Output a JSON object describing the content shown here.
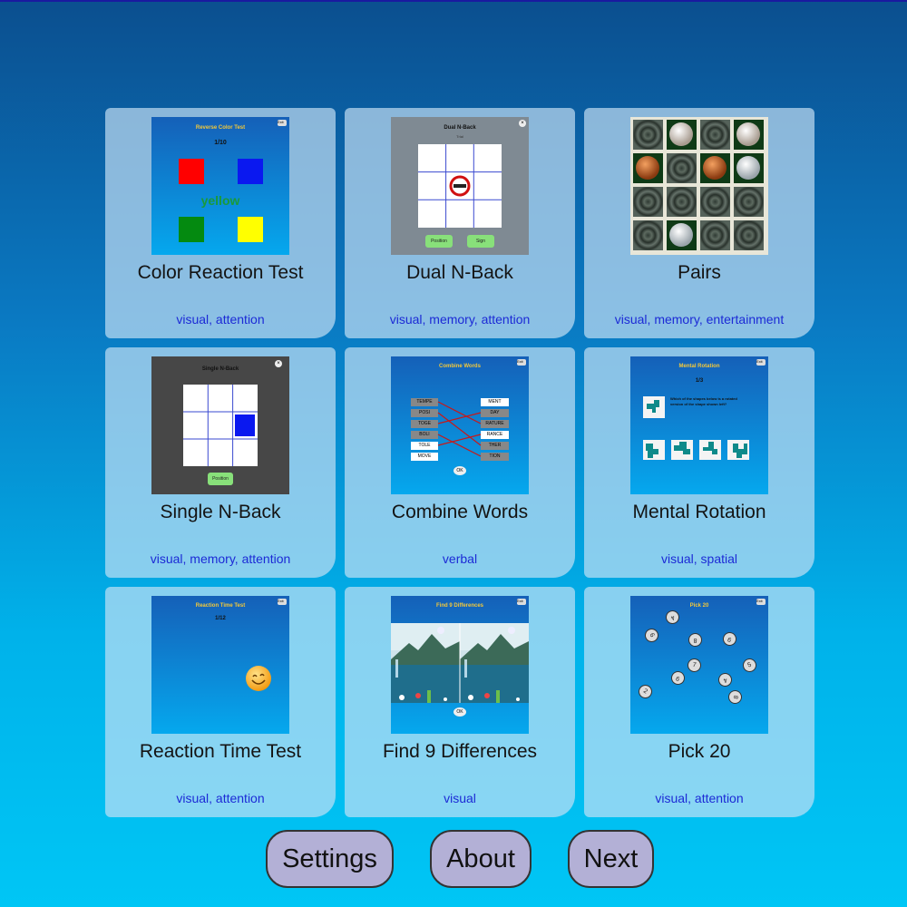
{
  "games": [
    {
      "title": "Color Reaction Test",
      "tags": "visual, attention"
    },
    {
      "title": "Dual N-Back",
      "tags": "visual, memory, attention"
    },
    {
      "title": "Pairs",
      "tags": "visual, memory, entertainment"
    },
    {
      "title": "Single N-Back",
      "tags": "visual, memory, attention"
    },
    {
      "title": "Combine Words",
      "tags": "verbal"
    },
    {
      "title": "Mental Rotation",
      "tags": "visual, spatial"
    },
    {
      "title": "Reaction Time Test",
      "tags": "visual, attention"
    },
    {
      "title": "Find 9 Differences",
      "tags": "visual"
    },
    {
      "title": "Pick 20",
      "tags": "visual, attention"
    }
  ],
  "thumbs": {
    "exit": "Exit",
    "color": {
      "title": "Reverse Color Test",
      "counter": "1/10",
      "word": "yellow"
    },
    "dual": {
      "title": "Dual N-Back",
      "sub": "Trial",
      "position": "Position",
      "sign": "Sign"
    },
    "single": {
      "title": "Single N-Back",
      "position": "Position"
    },
    "combine": {
      "title": "Combine Words",
      "left": [
        "TEMPE",
        "POSI",
        "TOGE",
        "BOLI",
        "TOLE",
        "MOVE"
      ],
      "right": [
        "MENT",
        "DAY",
        "RATURE",
        "RANCE",
        "THER",
        "TION"
      ],
      "ok": "OK"
    },
    "rotation": {
      "title": "Mental Rotation",
      "counter": "1/3",
      "question": "Which of the shapes below is a rotated version of the shape shown left?"
    },
    "reaction": {
      "title": "Reaction Time Test",
      "counter": "1/12"
    },
    "diff": {
      "title": "Find 9 Differences",
      "ok": "OK"
    },
    "pick": {
      "title": "Pick 20",
      "numbers": [
        "4",
        "6",
        "8",
        "9",
        "7",
        "9",
        "5",
        "2",
        "8",
        "4",
        "6"
      ]
    }
  },
  "buttons": {
    "settings": "Settings",
    "about": "About",
    "next": "Next"
  }
}
